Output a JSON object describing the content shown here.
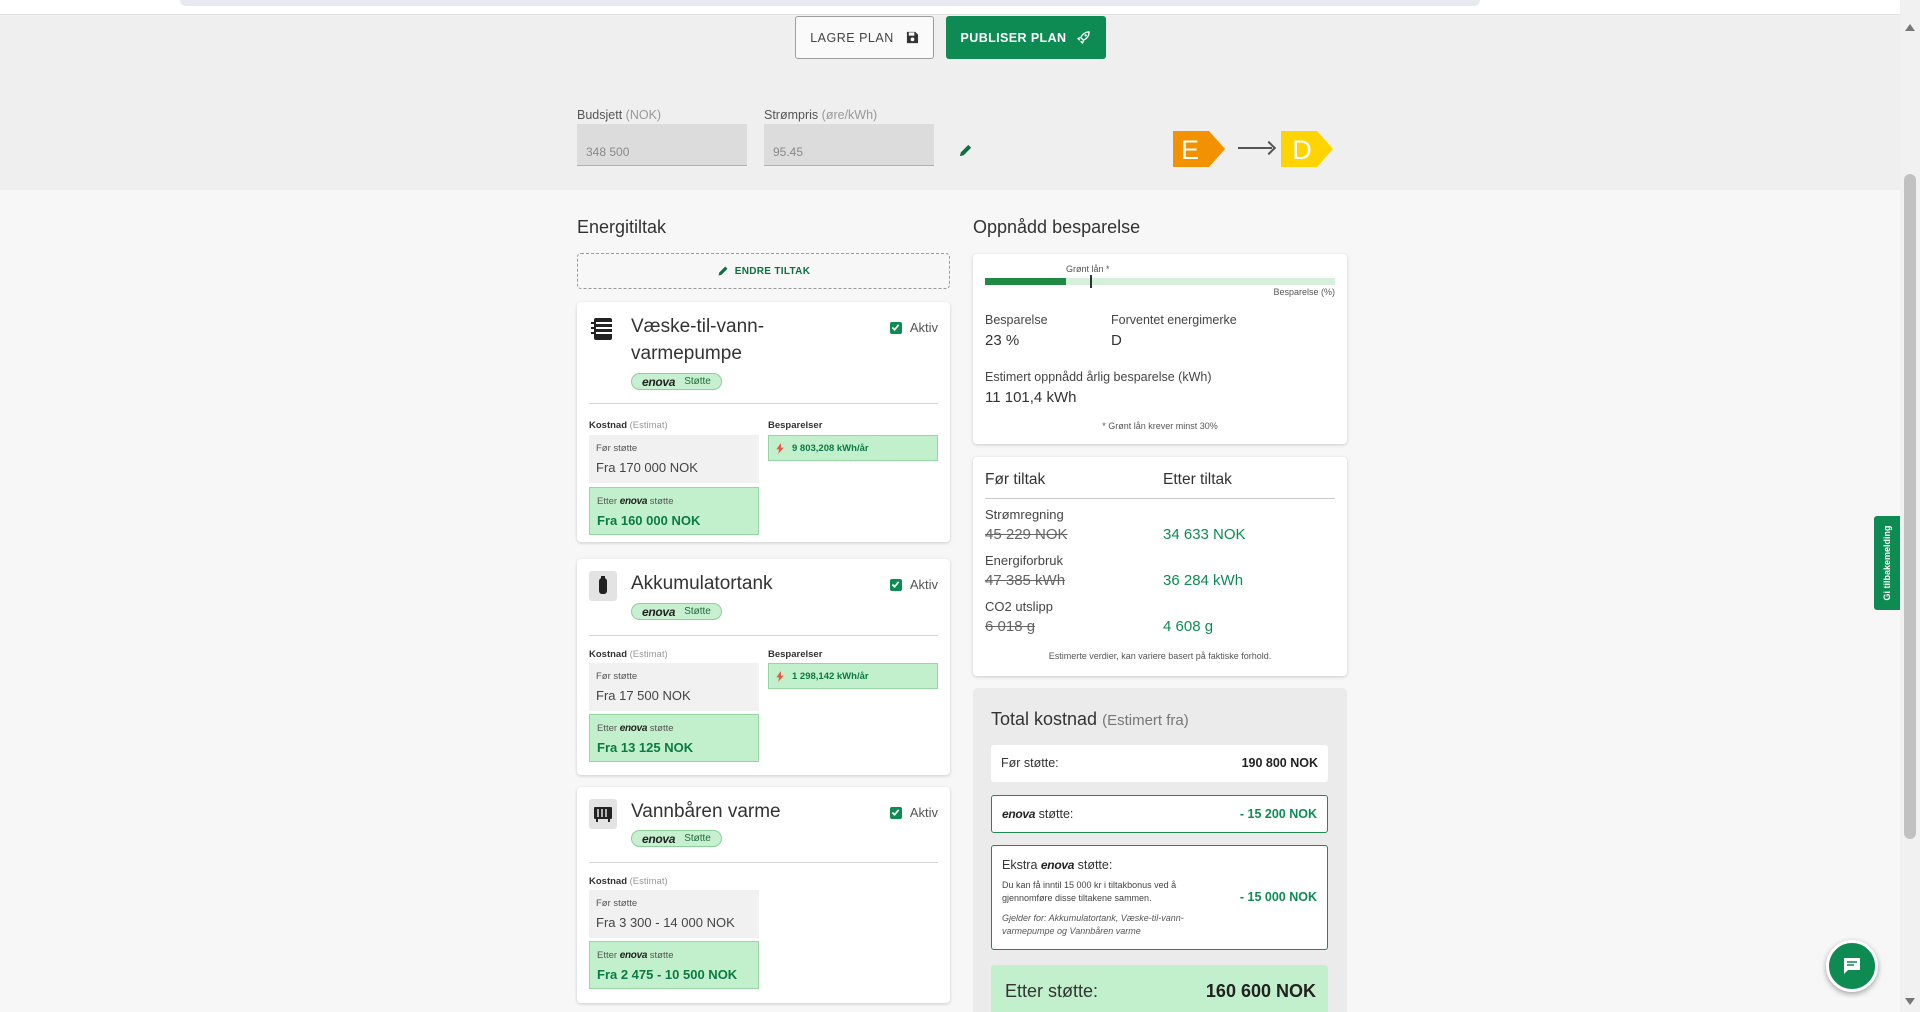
{
  "toolbar": {
    "save_label": "LAGRE PLAN",
    "publish_label": "PUBLISER PLAN"
  },
  "fields": {
    "budget_label": "Budsjett",
    "budget_unit": "(NOK)",
    "budget_value": "348 500",
    "price_label": "Strømpris",
    "price_unit": "(øre/kWh)",
    "price_value": "95.45"
  },
  "energy_labels": {
    "from": "E",
    "to": "D",
    "from_color": "#f39200",
    "to_color": "#ffd400"
  },
  "measures": {
    "title": "Energitiltak",
    "edit_label": "ENDRE TILTAK",
    "active_label": "Aktiv",
    "support_label": "Støtte",
    "enova_label": "enova",
    "cost_label": "Kostnad",
    "cost_muted": "(Estimat)",
    "savings_label": "Besparelser",
    "before_label": "Før støtte",
    "after_prefix": "Etter",
    "after_suffix": "støtte",
    "items": [
      {
        "name": "Væske-til-vann-varmepumpe",
        "icon": "heat-pump-icon",
        "before": "Fra 170 000 NOK",
        "after": "Fra 160 000 NOK",
        "savings": "9 803,208 kWh/år"
      },
      {
        "name": "Akkumulatortank",
        "icon": "tank-icon",
        "before": "Fra 17 500 NOK",
        "after": "Fra 13 125 NOK",
        "savings": "1 298,142 kWh/år"
      },
      {
        "name": "Vannbåren varme",
        "icon": "radiator-icon",
        "before": "Fra 3 300 - 14 000 NOK",
        "after": "Fra 2 475 - 10 500 NOK",
        "savings": ""
      }
    ]
  },
  "savings": {
    "title": "Oppnådd besparelse",
    "green_loan_label": "Grønt lån *",
    "progress_caption": "Besparelse (%)",
    "progress_value": 0.23,
    "green_loan_threshold": 0.3,
    "saving_label": "Besparelse",
    "saving_value": "23 %",
    "expected_label": "Forventet energimerke",
    "expected_value": "D",
    "annual_label": "Estimert oppnådd årlig besparelse (kWh)",
    "annual_value": "11 101,4 kWh",
    "note": "* Grønt lån krever minst 30%"
  },
  "comparison": {
    "before_head": "Før tiltak",
    "after_head": "Etter tiltak",
    "rows": [
      {
        "label": "Strømregning",
        "before": "45 229 NOK",
        "after": "34 633 NOK"
      },
      {
        "label": "Energiforbruk",
        "before": "47 385 kWh",
        "after": "36 284 kWh"
      },
      {
        "label": "CO2 utslipp",
        "before": "6 018 g",
        "after": "4 608 g"
      }
    ],
    "footnote": "Estimerte verdier, kan variere basert på faktiske forhold."
  },
  "total": {
    "title": "Total kostnad",
    "title_muted": "(Estimert fra)",
    "before_label": "Før støtte:",
    "before_value": "190 800 NOK",
    "enova_suffix": "støtte:",
    "enova_value": "- 15 200 NOK",
    "extra_prefix": "Ekstra",
    "extra_suffix": "støtte:",
    "extra_desc": "Du kan få inntil 15 000 kr i tiltakbonus ved å gjennomføre disse tiltakene sammen.",
    "extra_note": "Gjelder for: Akkumulatortank, Væske-til-vann-varmepumpe og Vannbåren varme",
    "extra_value": "- 15 000 NOK",
    "final_label": "Etter støtte:",
    "final_value": "160 600 NOK"
  },
  "feedback": {
    "label": "Gi tilbakemelding"
  },
  "colors": {
    "brand_green": "#0e8a53",
    "light_green": "#c3f0cc"
  }
}
